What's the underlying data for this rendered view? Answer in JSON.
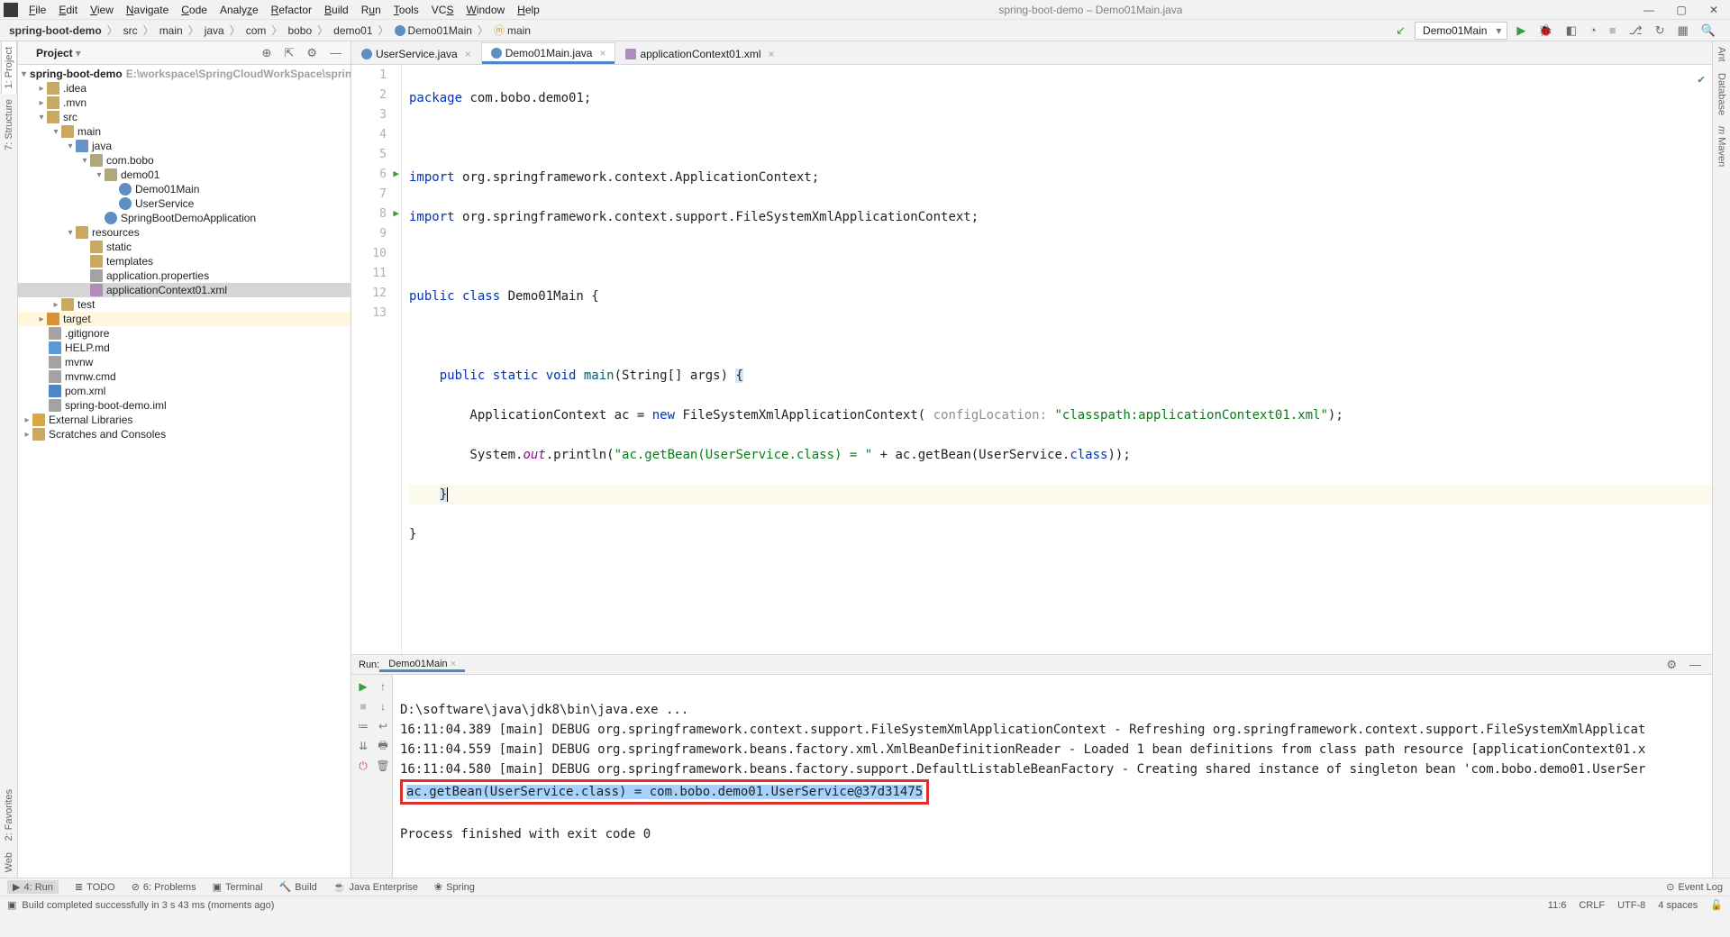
{
  "menu": [
    "File",
    "Edit",
    "View",
    "Navigate",
    "Code",
    "Analyze",
    "Refactor",
    "Build",
    "Run",
    "Tools",
    "VCS",
    "Window",
    "Help"
  ],
  "window_title": "spring-boot-demo – Demo01Main.java",
  "breadcrumb": [
    "spring-boot-demo",
    "src",
    "main",
    "java",
    "com",
    "bobo",
    "demo01",
    "Demo01Main",
    "main"
  ],
  "project_panel": {
    "title": "Project"
  },
  "tree": {
    "root": "spring-boot-demo",
    "root_path": "E:\\workspace\\SpringCloudWorkSpace\\spring-boot-d",
    "idea": ".idea",
    "mvn": ".mvn",
    "src": "src",
    "main": "main",
    "java": "java",
    "pkg": "com.bobo",
    "demo01": "demo01",
    "Demo01Main": "Demo01Main",
    "UserService": "UserService",
    "SpringBootDemoApplication": "SpringBootDemoApplication",
    "resources": "resources",
    "static": "static",
    "templates": "templates",
    "app_props": "application.properties",
    "app_ctx": "applicationContext01.xml",
    "test": "test",
    "target": "target",
    "gitignore": ".gitignore",
    "help_md": "HELP.md",
    "mvnw": "mvnw",
    "mvnw_cmd": "mvnw.cmd",
    "pom": "pom.xml",
    "iml": "spring-boot-demo.iml",
    "extlib": "External Libraries",
    "scratch": "Scratches and Consoles"
  },
  "tabs": [
    {
      "name": "UserService.java",
      "active": false,
      "icon": "ijava"
    },
    {
      "name": "Demo01Main.java",
      "active": true,
      "icon": "ijava"
    },
    {
      "name": "applicationContext01.xml",
      "active": false,
      "icon": "ixml"
    }
  ],
  "code": {
    "l1": "package com.bobo.demo01;",
    "l3a": "import ",
    "l3b": "org.springframework.context.ApplicationContext;",
    "l4a": "import ",
    "l4b": "org.springframework.context.support.FileSystemXmlApplicationContext;",
    "l6": "public class Demo01Main {",
    "l8": "    public static void main(String[] args) {",
    "l9a": "        ApplicationContext ac = ",
    "l9new": "new ",
    "l9b": "FileSystemXmlApplicationContext( ",
    "l9hint": "configLocation:",
    "l9str": " \"classpath:applicationContext01.xml\"",
    "l9c": ");",
    "l10a": "        System.",
    "l10out": "out",
    "l10b": ".println(",
    "l10str": "\"ac.getBean(UserService.class) = \"",
    "l10c": " + ac.getBean(UserService.class));",
    "l11": "    }",
    "l12": "}"
  },
  "line_numbers": [
    "1",
    "2",
    "3",
    "4",
    "5",
    "6",
    "7",
    "8",
    "9",
    "10",
    "11",
    "12",
    "13"
  ],
  "run": {
    "title": "Run:",
    "tab": "Demo01Main",
    "lines": [
      "D:\\software\\java\\jdk8\\bin\\java.exe ...",
      "16:11:04.389 [main] DEBUG org.springframework.context.support.FileSystemXmlApplicationContext - Refreshing org.springframework.context.support.FileSystemXmlApplicat",
      "16:11:04.559 [main] DEBUG org.springframework.beans.factory.xml.XmlBeanDefinitionReader - Loaded 1 bean definitions from class path resource [applicationContext01.x",
      "16:11:04.580 [main] DEBUG org.springframework.beans.factory.support.DefaultListableBeanFactory - Creating shared instance of singleton bean 'com.bobo.demo01.UserSer",
      "ac.getBean(UserService.class) = com.bobo.demo01.UserService@37d31475",
      "",
      "Process finished with exit code 0"
    ]
  },
  "toolwin": {
    "run": "4: Run",
    "todo": "TODO",
    "problems": "6: Problems",
    "terminal": "Terminal",
    "build": "Build",
    "javaee": "Java Enterprise",
    "spring": "Spring",
    "eventlog": "Event Log"
  },
  "status": {
    "msg": "Build completed successfully in 3 s 43 ms (moments ago)",
    "pos": "11:6",
    "le": "CRLF",
    "enc": "UTF-8",
    "indent": "4 spaces"
  },
  "run_config": "Demo01Main",
  "side_right": {
    "ant": "Ant",
    "db": "Database",
    "maven": "Maven"
  },
  "side_left": {
    "project": "1: Project",
    "structure": "7: Structure",
    "favorites": "2: Favorites",
    "web": "Web"
  }
}
